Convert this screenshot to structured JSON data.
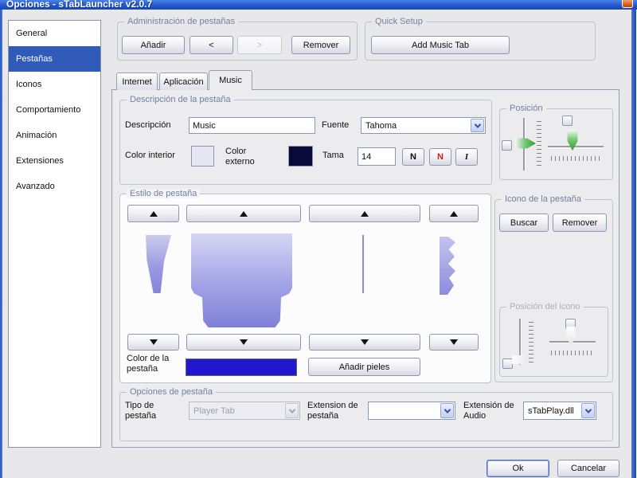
{
  "window": {
    "title": "Opciones - sTabLauncher v2.0.7"
  },
  "sidebar": {
    "items": [
      {
        "label": "General"
      },
      {
        "label": "Pestañas"
      },
      {
        "label": "Iconos"
      },
      {
        "label": "Comportamiento"
      },
      {
        "label": "Animación"
      },
      {
        "label": "Extensiones"
      },
      {
        "label": "Avanzado"
      }
    ],
    "selected_index": 1
  },
  "tab_admin": {
    "title": "Administración de pestañas",
    "add": "Añadir",
    "prev": "<",
    "next": ">",
    "remove": "Remover"
  },
  "quick_setup": {
    "title": "Quick Setup",
    "add_music_tab": "Add Music Tab"
  },
  "tab_strip": {
    "tabs": [
      {
        "label": "Internet"
      },
      {
        "label": "Aplicación"
      },
      {
        "label": "Music"
      }
    ],
    "active_index": 2
  },
  "description": {
    "title": "Descripción de la pestaña",
    "description_label": "Descripción",
    "description_value": "Music",
    "font_label": "Fuente",
    "font_value": "Tahoma",
    "inner_color_label": "Color interior",
    "inner_color": "#e6e6f4",
    "outer_color_label": "Color externo",
    "outer_color": "#0a0a38",
    "size_label": "Tama",
    "size_value": "14",
    "bold_label": "N",
    "bold_red_label": "N",
    "italic_label": "I"
  },
  "position": {
    "title": "Posición"
  },
  "style": {
    "title": "Estilo de pestaña",
    "tab_color_label": "Color de la pestaña",
    "tab_color": "#2118cd",
    "add_skins": "Añadir pieles"
  },
  "icon": {
    "title": "Icono de la pestaña",
    "browse": "Buscar",
    "remove": "Remover",
    "icon_position_title": "Posición del icono"
  },
  "options": {
    "title": "Opciones de pestaña",
    "type_label": "Tipo de pestaña",
    "type_value": "Player Tab",
    "tab_ext_label": "Extension de pestaña",
    "tab_ext_value": "",
    "audio_ext_label": "Extensión de Audio",
    "audio_ext_value": "sTabPlay.dll"
  },
  "footer": {
    "ok": "Ok",
    "cancel": "Cancelar"
  },
  "colors": {
    "titlebar": "#2057c8",
    "selection": "#315bb8",
    "skin_preview": "#9a9ae2"
  }
}
